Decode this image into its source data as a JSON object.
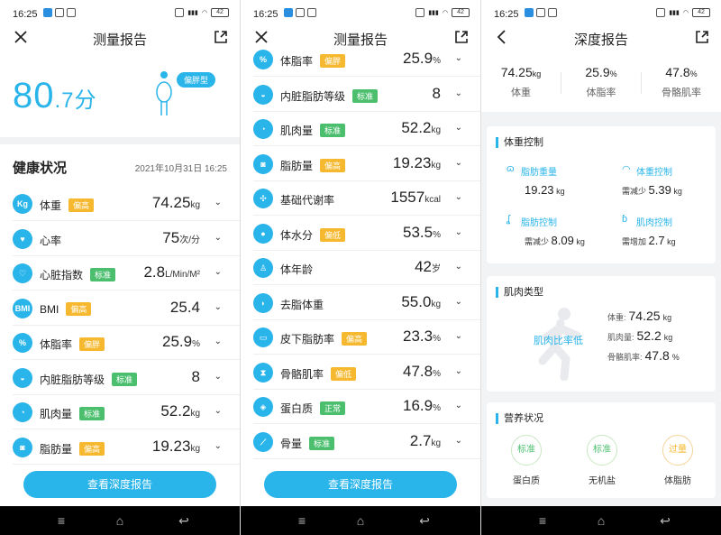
{
  "status": {
    "time": "16:25",
    "battery": "42"
  },
  "screen1": {
    "title": "测量报告",
    "score_int": "80",
    "score_dec": ".7",
    "score_unit": "分",
    "body_type": "偏胖型",
    "health_title": "健康状况",
    "date": "2021年10月31日 16:25",
    "rows": [
      {
        "icon": "Kg",
        "label": "体重",
        "badge": "偏高",
        "value": "74.25",
        "unit": "kg"
      },
      {
        "icon": "♥",
        "label": "心率",
        "badge": "",
        "value": "75",
        "unit": "次/分"
      },
      {
        "icon": "♡",
        "label": "心脏指数",
        "badge": "标准",
        "value": "2.8",
        "unit": "L/Min/M²"
      },
      {
        "icon": "BMI",
        "label": "BMI",
        "badge": "偏高",
        "value": "25.4",
        "unit": ""
      },
      {
        "icon": "%",
        "label": "体脂率",
        "badge": "偏胖",
        "value": "25.9",
        "unit": "%"
      },
      {
        "icon": "◒",
        "label": "内脏脂肪等级",
        "badge": "标准",
        "value": "8",
        "unit": ""
      },
      {
        "icon": "◔",
        "label": "肌肉量",
        "badge": "标准",
        "value": "52.2",
        "unit": "kg"
      },
      {
        "icon": "◙",
        "label": "脂肪量",
        "badge": "偏高",
        "value": "19.23",
        "unit": "kg"
      }
    ],
    "cta": "查看深度报告"
  },
  "screen2": {
    "title": "测量报告",
    "rows": [
      {
        "icon": "%",
        "label": "体脂率",
        "badge": "偏胖",
        "value": "25.9",
        "unit": "%"
      },
      {
        "icon": "◒",
        "label": "内脏脂肪等级",
        "badge": "标准",
        "value": "8",
        "unit": ""
      },
      {
        "icon": "◔",
        "label": "肌肉量",
        "badge": "标准",
        "value": "52.2",
        "unit": "kg"
      },
      {
        "icon": "◙",
        "label": "脂肪量",
        "badge": "偏高",
        "value": "19.23",
        "unit": "kg"
      },
      {
        "icon": "✣",
        "label": "基础代谢率",
        "badge": "",
        "value": "1557",
        "unit": "kcal"
      },
      {
        "icon": "●",
        "label": "体水分",
        "badge": "偏低",
        "value": "53.5",
        "unit": "%"
      },
      {
        "icon": "♙",
        "label": "体年龄",
        "badge": "",
        "value": "42",
        "unit": "岁"
      },
      {
        "icon": "◗",
        "label": "去脂体重",
        "badge": "",
        "value": "55.0",
        "unit": "kg"
      },
      {
        "icon": "▭",
        "label": "皮下脂肪率",
        "badge": "偏高",
        "value": "23.3",
        "unit": "%"
      },
      {
        "icon": "⧗",
        "label": "骨骼肌率",
        "badge": "偏低",
        "value": "47.8",
        "unit": "%"
      },
      {
        "icon": "◈",
        "label": "蛋白质",
        "badge": "正常",
        "value": "16.9",
        "unit": "%"
      },
      {
        "icon": "⟋",
        "label": "骨量",
        "badge": "标准",
        "value": "2.7",
        "unit": "kg"
      }
    ],
    "cta": "查看深度报告"
  },
  "screen3": {
    "title": "深度报告",
    "summary": [
      {
        "value": "74.25",
        "unit": "kg",
        "label": "体重"
      },
      {
        "value": "25.9",
        "unit": "%",
        "label": "体脂率"
      },
      {
        "value": "47.8",
        "unit": "%",
        "label": "骨骼肌率"
      }
    ],
    "weight_control": {
      "title": "体重控制",
      "cells": [
        {
          "icon": "ɷ",
          "name": "脂肪重量",
          "prefix": "",
          "value": "19.23",
          "unit": "kg"
        },
        {
          "icon": "◠",
          "name": "体重控制",
          "prefix": "需减少",
          "value": "5.39",
          "unit": "kg"
        },
        {
          "icon": "ʆ",
          "name": "脂肪控制",
          "prefix": "需减少",
          "value": "8.09",
          "unit": "kg"
        },
        {
          "icon": "ɓ",
          "name": "肌肉控制",
          "prefix": "需增加",
          "value": "2.7",
          "unit": "kg"
        }
      ]
    },
    "muscle_type": {
      "title": "肌肉类型",
      "classification": "肌肉比率低",
      "lines": [
        {
          "label": "体重:",
          "value": "74.25",
          "unit": "kg"
        },
        {
          "label": "肌肉量:",
          "value": "52.2",
          "unit": "kg"
        },
        {
          "label": "骨骼肌率:",
          "value": "47.8",
          "unit": "%"
        }
      ]
    },
    "nutrition": {
      "title": "营养状况",
      "items": [
        {
          "status": "标准",
          "label": "蛋白质"
        },
        {
          "status": "标准",
          "label": "无机盐"
        },
        {
          "status": "过量",
          "label": "体脂肪"
        }
      ]
    }
  },
  "colors": {
    "accent": "#29b4ea",
    "warn": "#f5b82e",
    "ok": "#4cbf6f"
  }
}
